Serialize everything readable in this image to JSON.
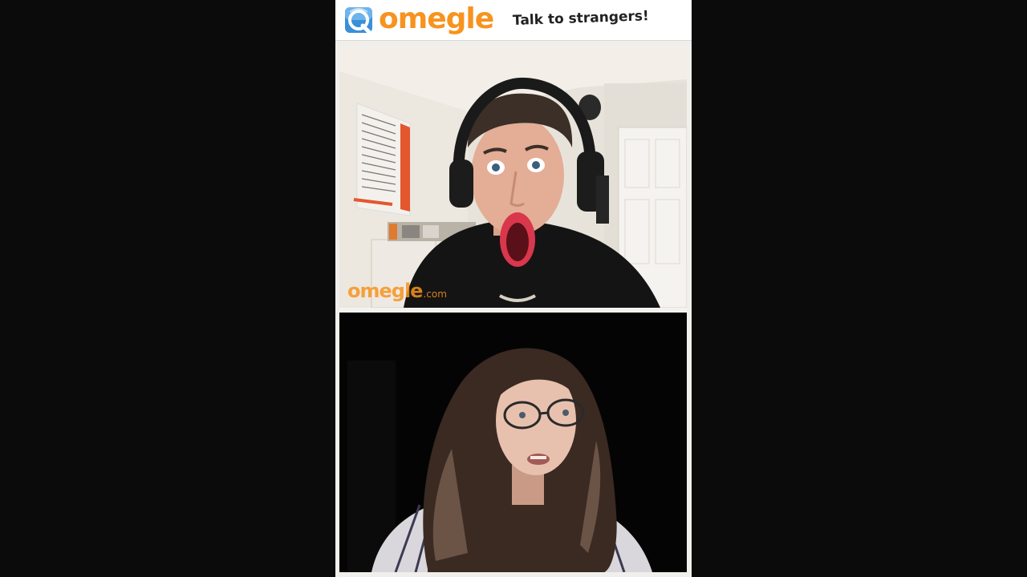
{
  "header": {
    "brand": "omegle",
    "tagline": "Talk to strangers!",
    "logo_icon": "omegle-logo-icon"
  },
  "stranger_video": {
    "watermark_brand": "omegle",
    "watermark_suffix": ".com"
  },
  "self_video": {},
  "colors": {
    "brand_orange": "#f7931e",
    "brand_blue": "#3a8fd9",
    "page_background": "#0b0b0b"
  }
}
